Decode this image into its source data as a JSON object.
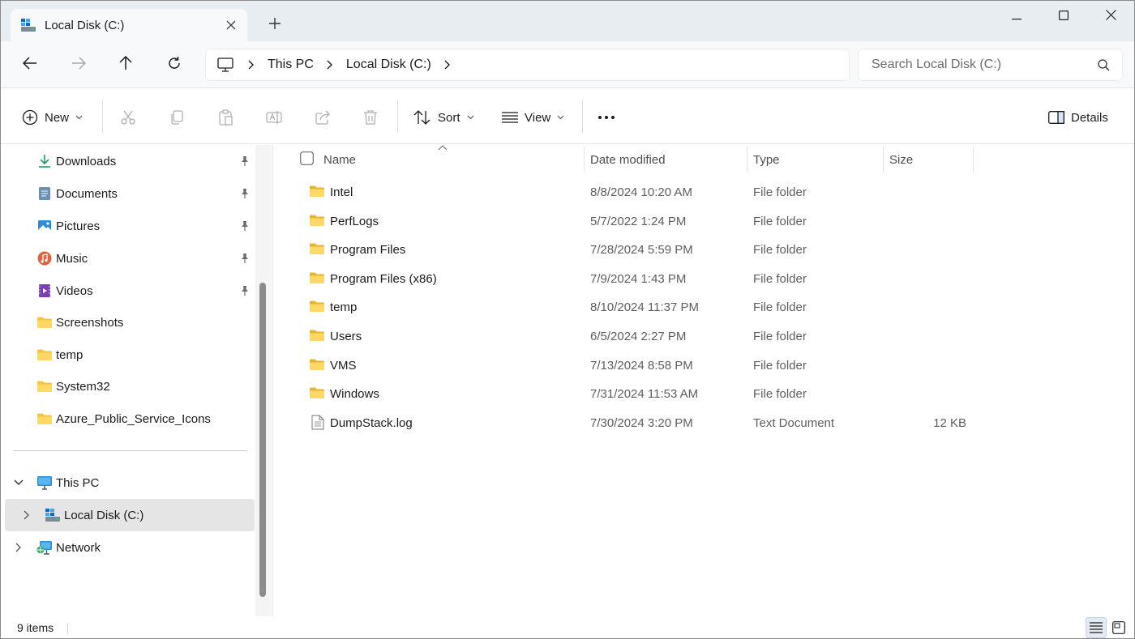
{
  "window": {
    "tab_title": "Local Disk (C:)",
    "controls": [
      "minimize-icon",
      "maximize-icon",
      "close-icon"
    ]
  },
  "nav": {
    "breadcrumbs": [
      "This PC",
      "Local Disk (C:)"
    ],
    "search_placeholder": "Search Local Disk (C:)"
  },
  "toolbar": {
    "new_label": "New",
    "sort_label": "Sort",
    "view_label": "View",
    "details_label": "Details"
  },
  "sidebar": {
    "quick_access": [
      {
        "label": "Downloads",
        "icon": "download-icon",
        "pinned": true
      },
      {
        "label": "Documents",
        "icon": "documents-icon",
        "pinned": true
      },
      {
        "label": "Pictures",
        "icon": "pictures-icon",
        "pinned": true
      },
      {
        "label": "Music",
        "icon": "music-icon",
        "pinned": true
      },
      {
        "label": "Videos",
        "icon": "videos-icon",
        "pinned": true
      },
      {
        "label": "Screenshots",
        "icon": "folder-icon",
        "pinned": false
      },
      {
        "label": "temp",
        "icon": "folder-icon",
        "pinned": false
      },
      {
        "label": "System32",
        "icon": "folder-icon",
        "pinned": false
      },
      {
        "label": "Azure_Public_Service_Icons",
        "icon": "folder-icon",
        "pinned": false
      }
    ],
    "tree": [
      {
        "label": "This PC",
        "icon": "computer-icon",
        "expanded": true
      },
      {
        "label": "Local Disk (C:)",
        "icon": "drive-icon",
        "selected": true
      },
      {
        "label": "Network",
        "icon": "network-icon",
        "expanded": false
      }
    ]
  },
  "filelist": {
    "columns": [
      "Name",
      "Date modified",
      "Type",
      "Size"
    ],
    "rows": [
      {
        "name": "Intel",
        "date": "8/8/2024 10:20 AM",
        "type": "File folder",
        "size": "",
        "icon": "folder-icon"
      },
      {
        "name": "PerfLogs",
        "date": "5/7/2022 1:24 PM",
        "type": "File folder",
        "size": "",
        "icon": "folder-icon"
      },
      {
        "name": "Program Files",
        "date": "7/28/2024 5:59 PM",
        "type": "File folder",
        "size": "",
        "icon": "folder-icon"
      },
      {
        "name": "Program Files (x86)",
        "date": "7/9/2024 1:43 PM",
        "type": "File folder",
        "size": "",
        "icon": "folder-icon"
      },
      {
        "name": "temp",
        "date": "8/10/2024 11:37 PM",
        "type": "File folder",
        "size": "",
        "icon": "folder-icon"
      },
      {
        "name": "Users",
        "date": "6/5/2024 2:27 PM",
        "type": "File folder",
        "size": "",
        "icon": "folder-icon"
      },
      {
        "name": "VMS",
        "date": "7/13/2024 8:58 PM",
        "type": "File folder",
        "size": "",
        "icon": "folder-icon"
      },
      {
        "name": "Windows",
        "date": "7/31/2024 11:53 AM",
        "type": "File folder",
        "size": "",
        "icon": "folder-icon"
      },
      {
        "name": "DumpStack.log",
        "date": "7/30/2024 3:20 PM",
        "type": "Text Document",
        "size": "12 KB",
        "icon": "text-file-icon"
      }
    ]
  },
  "status": {
    "item_count": "9 items"
  },
  "colors": {
    "folder": "#f4c542",
    "accent": "#0067c0",
    "titlebar_bg": "#e8edf2"
  }
}
